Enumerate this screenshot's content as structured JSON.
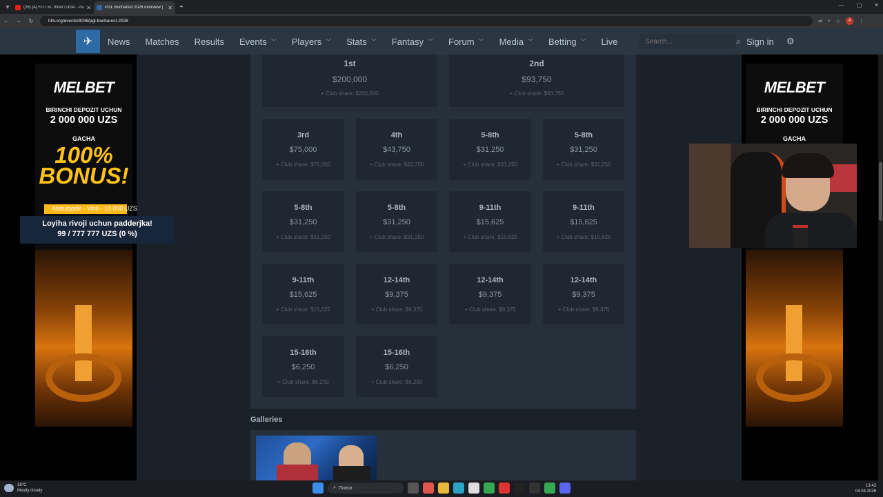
{
  "browser": {
    "tabs": [
      {
        "title": "(28) [A] FUT vs. Inner Circle - Pa",
        "active": false,
        "favicon_color": "#e62117"
      },
      {
        "title": "PGL Bucharest 2026 overview |",
        "active": true,
        "favicon_color": "#2e6aa6"
      }
    ],
    "url": "hltv.org/events/8048/pgl-bucharest-2026"
  },
  "nav": {
    "items": [
      {
        "label": "News",
        "dropdown": false
      },
      {
        "label": "Matches",
        "dropdown": false
      },
      {
        "label": "Results",
        "dropdown": false
      },
      {
        "label": "Events",
        "dropdown": true
      },
      {
        "label": "Players",
        "dropdown": true
      },
      {
        "label": "Stats",
        "dropdown": true
      },
      {
        "label": "Fantasy",
        "dropdown": true
      },
      {
        "label": "Forum",
        "dropdown": true
      },
      {
        "label": "Media",
        "dropdown": true
      },
      {
        "label": "Betting",
        "dropdown": true
      },
      {
        "label": "Live",
        "dropdown": false
      }
    ],
    "search_placeholder": "Search...",
    "sign_in": "Sign in"
  },
  "prizes": {
    "top": [
      {
        "place": "1st",
        "amount": "$200,000",
        "share": "+ Club share: $200,000"
      },
      {
        "place": "2nd",
        "amount": "$93,750",
        "share": "+ Club share: $93,750"
      }
    ],
    "rows": [
      [
        {
          "place": "3rd",
          "amount": "$75,000",
          "share": "+ Club share: $75,000"
        },
        {
          "place": "4th",
          "amount": "$43,750",
          "share": "+ Club share: $43,750"
        },
        {
          "place": "5-8th",
          "amount": "$31,250",
          "share": "+ Club share: $31,250"
        },
        {
          "place": "5-8th",
          "amount": "$31,250",
          "share": "+ Club share: $31,250"
        }
      ],
      [
        {
          "place": "5-8th",
          "amount": "$31,250",
          "share": "+ Club share: $31,250"
        },
        {
          "place": "5-8th",
          "amount": "$31,250",
          "share": "+ Club share: $31,250"
        },
        {
          "place": "9-11th",
          "amount": "$15,625",
          "share": "+ Club share: $15,625"
        },
        {
          "place": "9-11th",
          "amount": "$15,625",
          "share": "+ Club share: $15,625"
        }
      ],
      [
        {
          "place": "9-11th",
          "amount": "$15,625",
          "share": "+ Club share: $15,625"
        },
        {
          "place": "12-14th",
          "amount": "$9,375",
          "share": "+ Club share: $9,375"
        },
        {
          "place": "12-14th",
          "amount": "$9,375",
          "share": "+ Club share: $9,375"
        },
        {
          "place": "12-14th",
          "amount": "$9,375",
          "share": "+ Club share: $9,375"
        }
      ],
      [
        {
          "place": "15-16th",
          "amount": "$6,250",
          "share": "+ Club share: $6,250"
        },
        {
          "place": "15-16th",
          "amount": "$6,250",
          "share": "+ Club share: $6,250"
        }
      ]
    ]
  },
  "galleries": {
    "title": "Galleries"
  },
  "ads": {
    "brand": "MELBET",
    "line1": "BIRINCHI DEPOZIT UCHUN",
    "line2": "2 000 000 UZS",
    "line3": "GACHA",
    "bonus": "100% BONUS!"
  },
  "donation": {
    "notice": "Abdulqodir - Vinil - 10 000 UZS",
    "line1": "Loyiha rivoji uchun padderjka!",
    "line2": "99 / 777 777 UZS (0 %)"
  },
  "taskbar": {
    "temp": "18°C",
    "weather": "Mostly cloudy",
    "search": "Поиск",
    "time": "13:43",
    "date": "04.04.2026"
  }
}
